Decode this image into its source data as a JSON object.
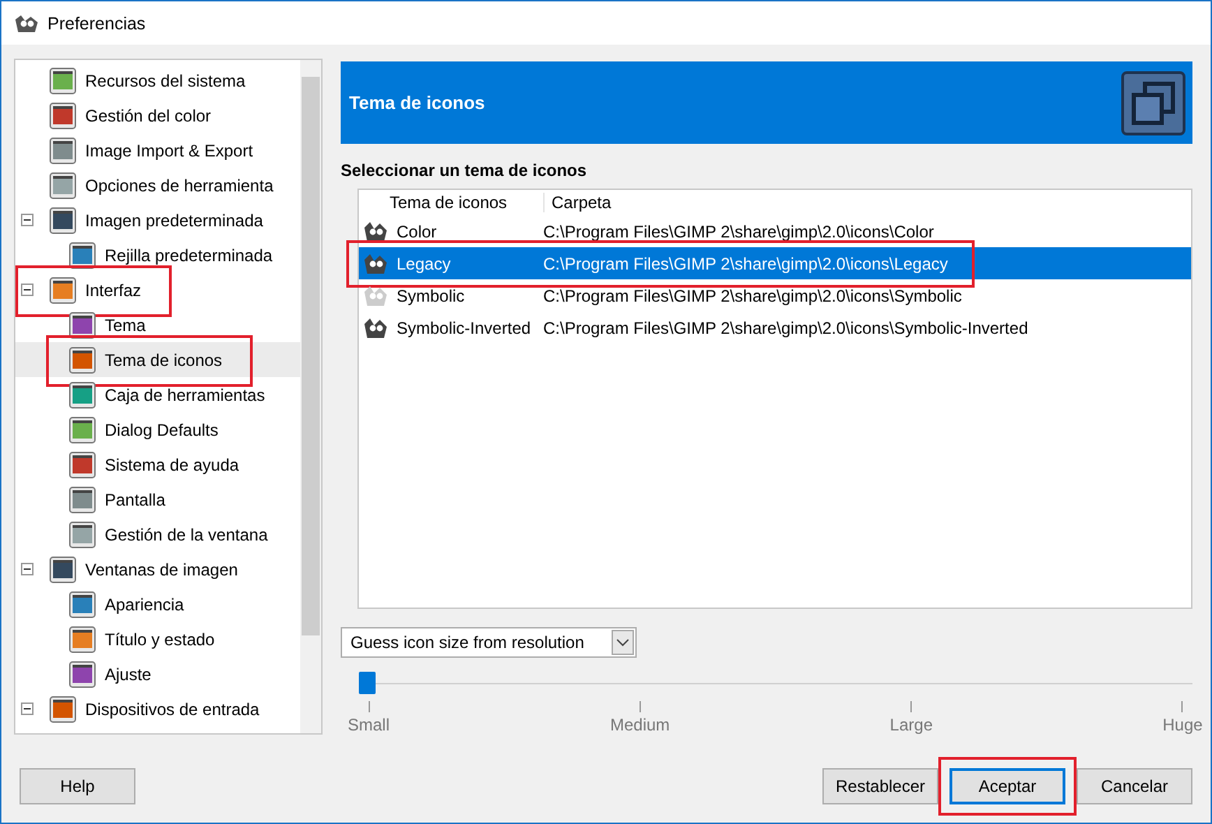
{
  "window": {
    "title": "Preferencias"
  },
  "sidebar": {
    "items": [
      {
        "label": "Recursos del sistema",
        "selected": false,
        "annotated": false
      },
      {
        "label": "Gestión del color",
        "selected": false,
        "annotated": false
      },
      {
        "label": "Image Import & Export",
        "selected": false,
        "annotated": false
      },
      {
        "label": "Opciones de herramienta",
        "selected": false,
        "annotated": false
      },
      {
        "label": "Imagen predeterminada",
        "selected": false,
        "annotated": false,
        "expanded": true,
        "children": [
          {
            "label": "Rejilla predeterminada",
            "selected": false,
            "annotated": false
          }
        ]
      },
      {
        "label": "Interfaz",
        "selected": false,
        "annotated": true,
        "expanded": true,
        "children": [
          {
            "label": "Tema",
            "selected": false,
            "annotated": false
          },
          {
            "label": "Tema de iconos",
            "selected": true,
            "annotated": true
          },
          {
            "label": "Caja de herramientas",
            "selected": false,
            "annotated": false
          },
          {
            "label": "Dialog Defaults",
            "selected": false,
            "annotated": false
          },
          {
            "label": "Sistema de ayuda",
            "selected": false,
            "annotated": false
          },
          {
            "label": "Pantalla",
            "selected": false,
            "annotated": false
          },
          {
            "label": "Gestión de la ventana",
            "selected": false,
            "annotated": false
          }
        ]
      },
      {
        "label": "Ventanas de imagen",
        "selected": false,
        "annotated": false,
        "expanded": true,
        "children": [
          {
            "label": "Apariencia",
            "selected": false,
            "annotated": false
          },
          {
            "label": "Título y estado",
            "selected": false,
            "annotated": false
          },
          {
            "label": "Ajuste",
            "selected": false,
            "annotated": false
          }
        ]
      },
      {
        "label": "Dispositivos de entrada",
        "selected": false,
        "annotated": false,
        "expanded": true
      }
    ]
  },
  "panel": {
    "title": "Tema de iconos",
    "section_label": "Seleccionar un tema de iconos",
    "table": {
      "columns": [
        "Tema de iconos",
        "Carpeta"
      ],
      "rows": [
        {
          "name": "Color",
          "folder": "C:\\Program Files\\GIMP 2\\share\\gimp\\2.0\\icons\\Color",
          "selected": false,
          "annotated": false
        },
        {
          "name": "Legacy",
          "folder": "C:\\Program Files\\GIMP 2\\share\\gimp\\2.0\\icons\\Legacy",
          "selected": true,
          "annotated": true
        },
        {
          "name": "Symbolic",
          "folder": "C:\\Program Files\\GIMP 2\\share\\gimp\\2.0\\icons\\Symbolic",
          "selected": false,
          "annotated": false
        },
        {
          "name": "Symbolic-Inverted",
          "folder": "C:\\Program Files\\GIMP 2\\share\\gimp\\2.0\\icons\\Symbolic-Inverted",
          "selected": false,
          "annotated": false
        }
      ]
    },
    "size_select": {
      "value": "Guess icon size from resolution"
    },
    "size_slider": {
      "level": 0,
      "labels": [
        "Small",
        "Medium",
        "Large",
        "Huge"
      ]
    }
  },
  "buttons": [
    {
      "label": "Help",
      "default": false,
      "annotated": false
    },
    {
      "label": "Restablecer",
      "default": false,
      "annotated": false
    },
    {
      "label": "Aceptar",
      "default": true,
      "annotated": true
    },
    {
      "label": "Cancelar",
      "default": false,
      "annotated": false
    }
  ]
}
